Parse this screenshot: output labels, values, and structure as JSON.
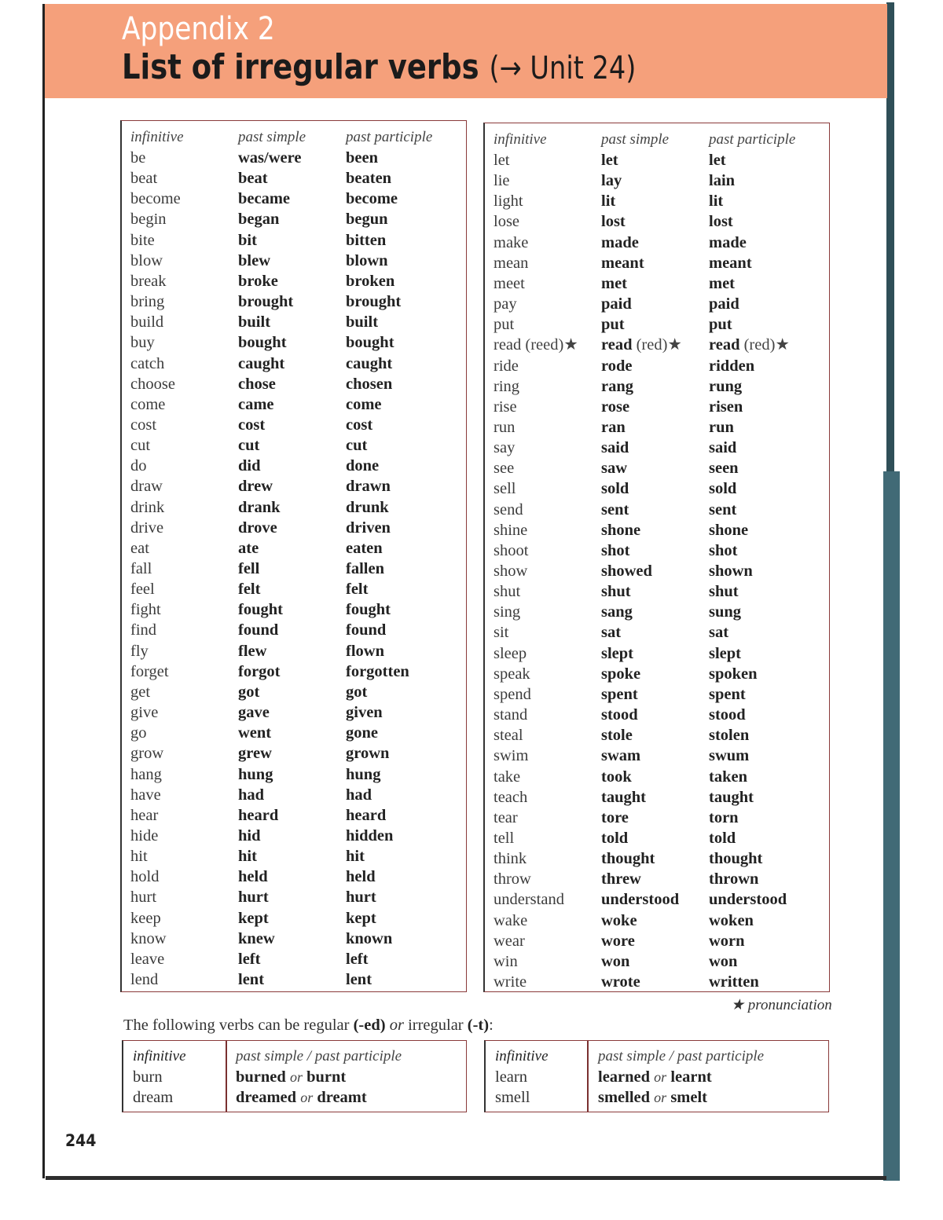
{
  "header": {
    "appendix": "Appendix 2",
    "title": "List of irregular verbs",
    "unit_ref": "(→ Unit 24)"
  },
  "columns": {
    "infinitive": "infinitive",
    "past_simple": "past simple",
    "past_participle": "past participle"
  },
  "left_table": [
    [
      "be",
      "was/were",
      "been"
    ],
    [
      "beat",
      "beat",
      "beaten"
    ],
    [
      "become",
      "became",
      "become"
    ],
    [
      "begin",
      "began",
      "begun"
    ],
    [
      "bite",
      "bit",
      "bitten"
    ],
    [
      "blow",
      "blew",
      "blown"
    ],
    [
      "break",
      "broke",
      "broken"
    ],
    [
      "bring",
      "brought",
      "brought"
    ],
    [
      "build",
      "built",
      "built"
    ],
    [
      "buy",
      "bought",
      "bought"
    ],
    [
      "catch",
      "caught",
      "caught"
    ],
    [
      "choose",
      "chose",
      "chosen"
    ],
    [
      "come",
      "came",
      "come"
    ],
    [
      "cost",
      "cost",
      "cost"
    ],
    [
      "cut",
      "cut",
      "cut"
    ],
    [
      "do",
      "did",
      "done"
    ],
    [
      "draw",
      "drew",
      "drawn"
    ],
    [
      "drink",
      "drank",
      "drunk"
    ],
    [
      "drive",
      "drove",
      "driven"
    ],
    [
      "eat",
      "ate",
      "eaten"
    ],
    [
      "fall",
      "fell",
      "fallen"
    ],
    [
      "feel",
      "felt",
      "felt"
    ],
    [
      "fight",
      "fought",
      "fought"
    ],
    [
      "find",
      "found",
      "found"
    ],
    [
      "fly",
      "flew",
      "flown"
    ],
    [
      "forget",
      "forgot",
      "forgotten"
    ],
    [
      "get",
      "got",
      "got"
    ],
    [
      "give",
      "gave",
      "given"
    ],
    [
      "go",
      "went",
      "gone"
    ],
    [
      "grow",
      "grew",
      "grown"
    ],
    [
      "hang",
      "hung",
      "hung"
    ],
    [
      "have",
      "had",
      "had"
    ],
    [
      "hear",
      "heard",
      "heard"
    ],
    [
      "hide",
      "hid",
      "hidden"
    ],
    [
      "hit",
      "hit",
      "hit"
    ],
    [
      "hold",
      "held",
      "held"
    ],
    [
      "hurt",
      "hurt",
      "hurt"
    ],
    [
      "keep",
      "kept",
      "kept"
    ],
    [
      "know",
      "knew",
      "known"
    ],
    [
      "leave",
      "left",
      "left"
    ],
    [
      "lend",
      "lent",
      "lent"
    ]
  ],
  "right_table": [
    [
      "let",
      "let",
      "let"
    ],
    [
      "lie",
      "lay",
      "lain"
    ],
    [
      "light",
      "lit",
      "lit"
    ],
    [
      "lose",
      "lost",
      "lost"
    ],
    [
      "make",
      "made",
      "made"
    ],
    [
      "mean",
      "meant",
      "meant"
    ],
    [
      "meet",
      "met",
      "met"
    ],
    [
      "pay",
      "paid",
      "paid"
    ],
    [
      "put",
      "put",
      "put"
    ],
    [
      "read",
      "read",
      "read"
    ],
    [
      "ride",
      "rode",
      "ridden"
    ],
    [
      "ring",
      "rang",
      "rung"
    ],
    [
      "rise",
      "rose",
      "risen"
    ],
    [
      "run",
      "ran",
      "run"
    ],
    [
      "say",
      "said",
      "said"
    ],
    [
      "see",
      "saw",
      "seen"
    ],
    [
      "sell",
      "sold",
      "sold"
    ],
    [
      "send",
      "sent",
      "sent"
    ],
    [
      "shine",
      "shone",
      "shone"
    ],
    [
      "shoot",
      "shot",
      "shot"
    ],
    [
      "show",
      "showed",
      "shown"
    ],
    [
      "shut",
      "shut",
      "shut"
    ],
    [
      "sing",
      "sang",
      "sung"
    ],
    [
      "sit",
      "sat",
      "sat"
    ],
    [
      "sleep",
      "slept",
      "slept"
    ],
    [
      "speak",
      "spoke",
      "spoken"
    ],
    [
      "spend",
      "spent",
      "spent"
    ],
    [
      "stand",
      "stood",
      "stood"
    ],
    [
      "steal",
      "stole",
      "stolen"
    ],
    [
      "swim",
      "swam",
      "swum"
    ],
    [
      "take",
      "took",
      "taken"
    ],
    [
      "teach",
      "taught",
      "taught"
    ],
    [
      "tear",
      "tore",
      "torn"
    ],
    [
      "tell",
      "told",
      "told"
    ],
    [
      "think",
      "thought",
      "thought"
    ],
    [
      "throw",
      "threw",
      "thrown"
    ],
    [
      "understand",
      "understood",
      "understood"
    ],
    [
      "wake",
      "woke",
      "woken"
    ],
    [
      "wear",
      "wore",
      "worn"
    ],
    [
      "win",
      "won",
      "won"
    ],
    [
      "write",
      "wrote",
      "written"
    ]
  ],
  "read_notes": {
    "infinitive": "(reed)★",
    "past_simple": "(red)★",
    "past_participle": "(red)★"
  },
  "pronunciation_note": "★ pronunciation",
  "regular_intro": {
    "before": "The following verbs can be regular ",
    "ed": "(-ed)",
    "or": "or",
    "mid": " irregular ",
    "t": "(-t)",
    "after": ":"
  },
  "mini_columns": {
    "infinitive": "infinitive",
    "forms": "past simple / past participle"
  },
  "or_word": "or",
  "mini_left": [
    {
      "infinitive": "burn",
      "regular": "burned",
      "irregular": "burnt"
    },
    {
      "infinitive": "dream",
      "regular": "dreamed",
      "irregular": "dreamt"
    }
  ],
  "mini_right": [
    {
      "infinitive": "learn",
      "regular": "learned",
      "irregular": "learnt"
    },
    {
      "infinitive": "smell",
      "regular": "smelled",
      "irregular": "smelt"
    }
  ],
  "page_number": "244",
  "colors": {
    "header_band": "#f5a07b",
    "teal_edge": "#416a76",
    "table_border": "#8a3a3a"
  }
}
